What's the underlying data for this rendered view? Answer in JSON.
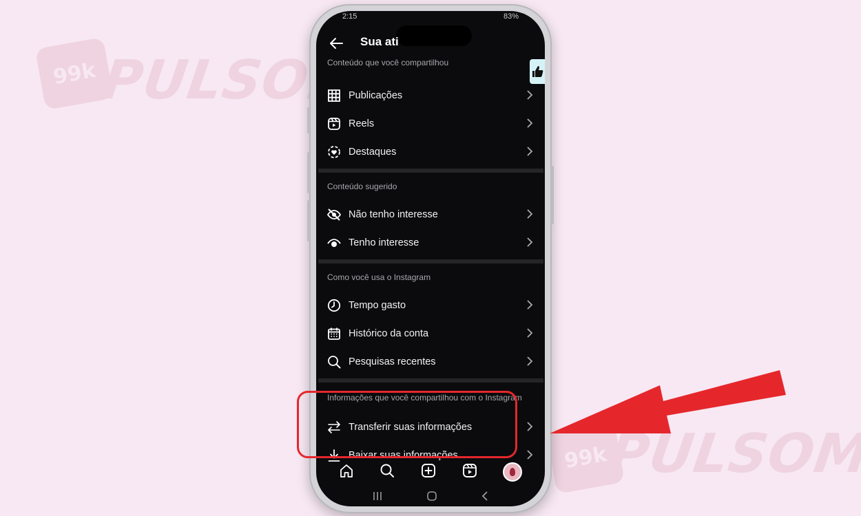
{
  "watermark": {
    "brand_text": "PULSOMAX",
    "badge_text": "99k"
  },
  "status_bar": {
    "time": "2:15",
    "battery": "83%"
  },
  "header": {
    "title": "Sua ati"
  },
  "sections": [
    {
      "heading": "Conteúdo que você compartilhou",
      "items": [
        {
          "label": "Publicações",
          "icon": "grid-icon"
        },
        {
          "label": "Reels",
          "icon": "reels-icon"
        },
        {
          "label": "Destaques",
          "icon": "highlight-icon"
        }
      ]
    },
    {
      "heading": "Conteúdo sugerido",
      "items": [
        {
          "label": "Não tenho interesse",
          "icon": "eye-off-icon"
        },
        {
          "label": "Tenho interesse",
          "icon": "eye-icon"
        }
      ]
    },
    {
      "heading": "Como você usa o Instagram",
      "items": [
        {
          "label": "Tempo gasto",
          "icon": "clock-icon"
        },
        {
          "label": "Histórico da conta",
          "icon": "calendar-icon"
        },
        {
          "label": "Pesquisas recentes",
          "icon": "search-icon"
        }
      ]
    },
    {
      "heading": "Informações que você compartilhou com o Instagram",
      "items": [
        {
          "label": "Transferir suas informações",
          "icon": "transfer-icon"
        },
        {
          "label": "Baixar suas informações",
          "icon": "download-icon"
        }
      ]
    }
  ],
  "bottom_nav": [
    "home-icon",
    "search-icon",
    "create-icon",
    "reels-icon",
    "profile-avatar"
  ],
  "colors": {
    "background": "#f7e8f3",
    "screen": "#0b0b0d",
    "accent_red": "#e5272c",
    "text": "#f2f2f2",
    "subtle": "#a8a8ad"
  }
}
